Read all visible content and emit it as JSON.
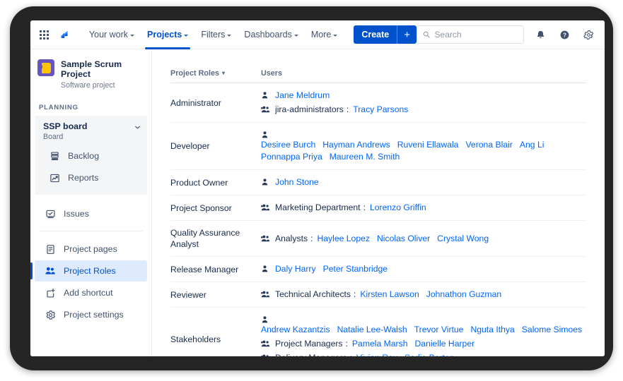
{
  "topnav": {
    "app_switcher_icon": "grid-apps-icon",
    "logo_icon": "jira-logo-icon",
    "items": [
      {
        "label": "Your work",
        "has_caret": true,
        "active": false
      },
      {
        "label": "Projects",
        "has_caret": true,
        "active": true
      },
      {
        "label": "Filters",
        "has_caret": true,
        "active": false
      },
      {
        "label": "Dashboards",
        "has_caret": true,
        "active": false
      },
      {
        "label": "More",
        "has_caret": true,
        "active": false
      }
    ],
    "create_label": "Create",
    "create_plus": "+",
    "search_placeholder": "Search",
    "search_value": "",
    "icons": [
      "search-icon",
      "notifications-bell-icon",
      "help-icon",
      "settings-gear-icon"
    ],
    "accent_color": "#0052CC"
  },
  "sidebar": {
    "project_name": "Sample Scrum Project",
    "project_type": "Software project",
    "avatar_icon": "project-avatar-icon",
    "section_label": "PLANNING",
    "board": {
      "name": "SSP board",
      "subtitle": "Board",
      "chevron_icon": "chevron-down-icon"
    },
    "board_items": [
      {
        "label": "Backlog",
        "icon": "backlog-icon"
      },
      {
        "label": "Reports",
        "icon": "reports-chart-icon"
      }
    ],
    "standalone_items": [
      {
        "label": "Issues",
        "icon": "issues-icon"
      }
    ],
    "lower_items": [
      {
        "label": "Project pages",
        "icon": "pages-icon",
        "selected": false
      },
      {
        "label": "Project Roles",
        "icon": "people-group-icon",
        "selected": true
      },
      {
        "label": "Add shortcut",
        "icon": "add-shortcut-icon",
        "selected": false
      },
      {
        "label": "Project settings",
        "icon": "settings-gear-icon",
        "selected": false
      }
    ],
    "selected_color": "#0052CC"
  },
  "main": {
    "columns": {
      "role": "Project Roles",
      "users": "Users",
      "sort_indicator": "▾"
    },
    "rows": [
      {
        "role": "Administrator",
        "lines": [
          {
            "icon": "user-icon",
            "group": "",
            "people": [
              "Jane Meldrum"
            ]
          },
          {
            "icon": "group-icon",
            "group": "jira-administrators",
            "people": [
              "Tracy Parsons"
            ]
          }
        ]
      },
      {
        "role": "Developer",
        "lines": [
          {
            "icon": "user-icon",
            "group": "",
            "people": [
              "Desiree Burch",
              "Hayman Andrews",
              "Ruveni Ellawala",
              "Verona Blair",
              "Ang Li",
              "Ponnappa Priya",
              "Maureen M. Smith"
            ]
          }
        ]
      },
      {
        "role": "Product Owner",
        "lines": [
          {
            "icon": "user-icon",
            "group": "",
            "people": [
              "John Stone"
            ]
          }
        ]
      },
      {
        "role": "Project Sponsor",
        "lines": [
          {
            "icon": "group-icon",
            "group": "Marketing Department",
            "people": [
              "Lorenzo Griffin"
            ]
          }
        ]
      },
      {
        "role": "Quality Assurance Analyst",
        "lines": [
          {
            "icon": "group-icon",
            "group": "Analysts",
            "people": [
              "Haylee Lopez",
              "Nicolas Oliver",
              "Crystal Wong"
            ]
          }
        ]
      },
      {
        "role": "Release Manager",
        "lines": [
          {
            "icon": "user-icon",
            "group": "",
            "people": [
              "Daly Harry",
              "Peter Stanbridge"
            ]
          }
        ]
      },
      {
        "role": "Reviewer",
        "lines": [
          {
            "icon": "group-icon",
            "group": "Technical Architects",
            "people": [
              "Kirsten Lawson",
              "Johnathon Guzman"
            ]
          }
        ]
      },
      {
        "role": "Stakeholders",
        "lines": [
          {
            "icon": "user-icon",
            "group": "",
            "people": [
              "Andrew Kazantzis",
              "Natalie Lee-Walsh",
              "Trevor Virtue",
              "Nguta Ithya",
              "Salome Simoes"
            ]
          },
          {
            "icon": "group-icon",
            "group": "Project Managers",
            "people": [
              "Pamela Marsh",
              "Danielle Harper"
            ]
          },
          {
            "icon": "group-icon",
            "group": "Delivery Managers",
            "people": [
              "Vivian Ray",
              "Sadie Barton"
            ]
          }
        ]
      }
    ],
    "link_color": "#0065FF",
    "group_separator": ":"
  }
}
